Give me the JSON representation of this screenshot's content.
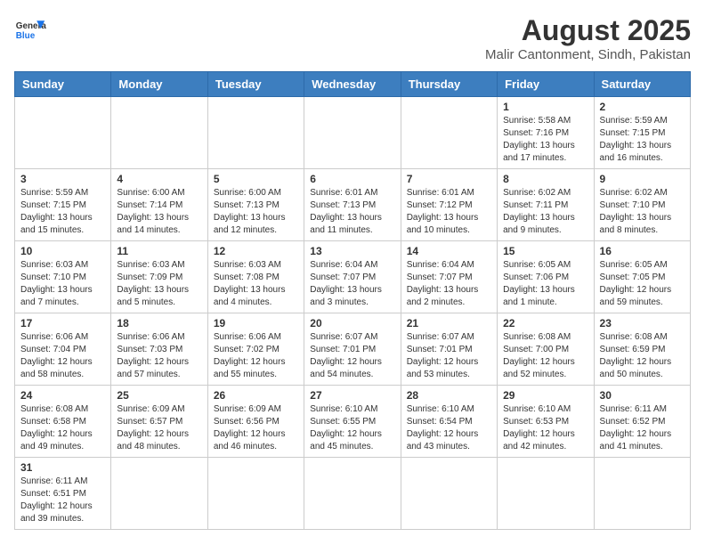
{
  "header": {
    "logo_general": "General",
    "logo_blue": "Blue",
    "title": "August 2025",
    "subtitle": "Malir Cantonment, Sindh, Pakistan"
  },
  "weekdays": [
    "Sunday",
    "Monday",
    "Tuesday",
    "Wednesday",
    "Thursday",
    "Friday",
    "Saturday"
  ],
  "weeks": [
    [
      {
        "day": "",
        "info": ""
      },
      {
        "day": "",
        "info": ""
      },
      {
        "day": "",
        "info": ""
      },
      {
        "day": "",
        "info": ""
      },
      {
        "day": "",
        "info": ""
      },
      {
        "day": "1",
        "info": "Sunrise: 5:58 AM\nSunset: 7:16 PM\nDaylight: 13 hours and 17 minutes."
      },
      {
        "day": "2",
        "info": "Sunrise: 5:59 AM\nSunset: 7:15 PM\nDaylight: 13 hours and 16 minutes."
      }
    ],
    [
      {
        "day": "3",
        "info": "Sunrise: 5:59 AM\nSunset: 7:15 PM\nDaylight: 13 hours and 15 minutes."
      },
      {
        "day": "4",
        "info": "Sunrise: 6:00 AM\nSunset: 7:14 PM\nDaylight: 13 hours and 14 minutes."
      },
      {
        "day": "5",
        "info": "Sunrise: 6:00 AM\nSunset: 7:13 PM\nDaylight: 13 hours and 12 minutes."
      },
      {
        "day": "6",
        "info": "Sunrise: 6:01 AM\nSunset: 7:13 PM\nDaylight: 13 hours and 11 minutes."
      },
      {
        "day": "7",
        "info": "Sunrise: 6:01 AM\nSunset: 7:12 PM\nDaylight: 13 hours and 10 minutes."
      },
      {
        "day": "8",
        "info": "Sunrise: 6:02 AM\nSunset: 7:11 PM\nDaylight: 13 hours and 9 minutes."
      },
      {
        "day": "9",
        "info": "Sunrise: 6:02 AM\nSunset: 7:10 PM\nDaylight: 13 hours and 8 minutes."
      }
    ],
    [
      {
        "day": "10",
        "info": "Sunrise: 6:03 AM\nSunset: 7:10 PM\nDaylight: 13 hours and 7 minutes."
      },
      {
        "day": "11",
        "info": "Sunrise: 6:03 AM\nSunset: 7:09 PM\nDaylight: 13 hours and 5 minutes."
      },
      {
        "day": "12",
        "info": "Sunrise: 6:03 AM\nSunset: 7:08 PM\nDaylight: 13 hours and 4 minutes."
      },
      {
        "day": "13",
        "info": "Sunrise: 6:04 AM\nSunset: 7:07 PM\nDaylight: 13 hours and 3 minutes."
      },
      {
        "day": "14",
        "info": "Sunrise: 6:04 AM\nSunset: 7:07 PM\nDaylight: 13 hours and 2 minutes."
      },
      {
        "day": "15",
        "info": "Sunrise: 6:05 AM\nSunset: 7:06 PM\nDaylight: 13 hours and 1 minute."
      },
      {
        "day": "16",
        "info": "Sunrise: 6:05 AM\nSunset: 7:05 PM\nDaylight: 12 hours and 59 minutes."
      }
    ],
    [
      {
        "day": "17",
        "info": "Sunrise: 6:06 AM\nSunset: 7:04 PM\nDaylight: 12 hours and 58 minutes."
      },
      {
        "day": "18",
        "info": "Sunrise: 6:06 AM\nSunset: 7:03 PM\nDaylight: 12 hours and 57 minutes."
      },
      {
        "day": "19",
        "info": "Sunrise: 6:06 AM\nSunset: 7:02 PM\nDaylight: 12 hours and 55 minutes."
      },
      {
        "day": "20",
        "info": "Sunrise: 6:07 AM\nSunset: 7:01 PM\nDaylight: 12 hours and 54 minutes."
      },
      {
        "day": "21",
        "info": "Sunrise: 6:07 AM\nSunset: 7:01 PM\nDaylight: 12 hours and 53 minutes."
      },
      {
        "day": "22",
        "info": "Sunrise: 6:08 AM\nSunset: 7:00 PM\nDaylight: 12 hours and 52 minutes."
      },
      {
        "day": "23",
        "info": "Sunrise: 6:08 AM\nSunset: 6:59 PM\nDaylight: 12 hours and 50 minutes."
      }
    ],
    [
      {
        "day": "24",
        "info": "Sunrise: 6:08 AM\nSunset: 6:58 PM\nDaylight: 12 hours and 49 minutes."
      },
      {
        "day": "25",
        "info": "Sunrise: 6:09 AM\nSunset: 6:57 PM\nDaylight: 12 hours and 48 minutes."
      },
      {
        "day": "26",
        "info": "Sunrise: 6:09 AM\nSunset: 6:56 PM\nDaylight: 12 hours and 46 minutes."
      },
      {
        "day": "27",
        "info": "Sunrise: 6:10 AM\nSunset: 6:55 PM\nDaylight: 12 hours and 45 minutes."
      },
      {
        "day": "28",
        "info": "Sunrise: 6:10 AM\nSunset: 6:54 PM\nDaylight: 12 hours and 43 minutes."
      },
      {
        "day": "29",
        "info": "Sunrise: 6:10 AM\nSunset: 6:53 PM\nDaylight: 12 hours and 42 minutes."
      },
      {
        "day": "30",
        "info": "Sunrise: 6:11 AM\nSunset: 6:52 PM\nDaylight: 12 hours and 41 minutes."
      }
    ],
    [
      {
        "day": "31",
        "info": "Sunrise: 6:11 AM\nSunset: 6:51 PM\nDaylight: 12 hours and 39 minutes."
      },
      {
        "day": "",
        "info": ""
      },
      {
        "day": "",
        "info": ""
      },
      {
        "day": "",
        "info": ""
      },
      {
        "day": "",
        "info": ""
      },
      {
        "day": "",
        "info": ""
      },
      {
        "day": "",
        "info": ""
      }
    ]
  ]
}
